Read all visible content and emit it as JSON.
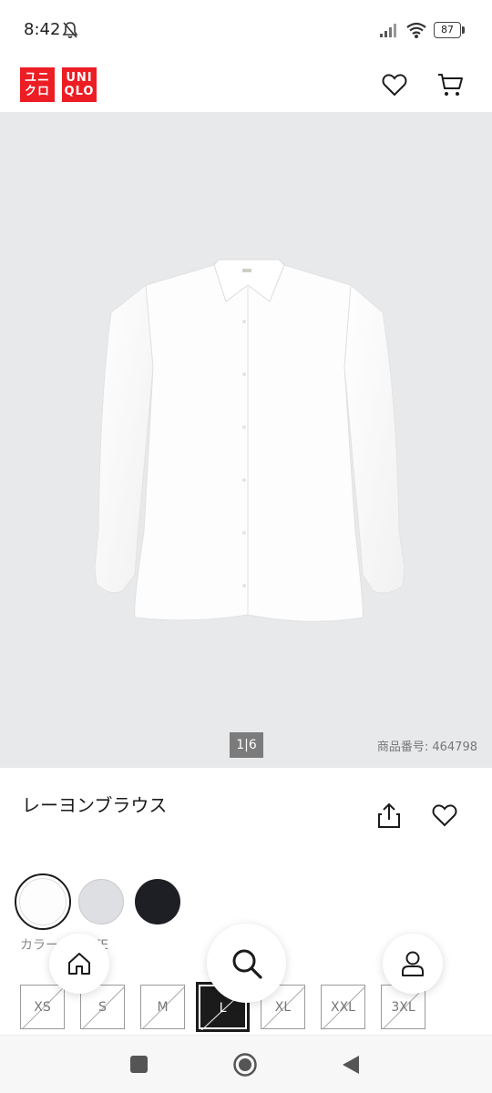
{
  "status_bar": {
    "time": "8:42",
    "battery": "87",
    "icons": [
      "bell-off-icon",
      "signal-icon",
      "wifi-icon",
      "battery-icon"
    ]
  },
  "header": {
    "logo": {
      "katakana_lines": [
        "ユニ",
        "クロ"
      ],
      "latin_lines": [
        "UNI",
        "QLO"
      ],
      "color": "#ed1d24"
    },
    "icons": [
      "heart-icon",
      "cart-icon"
    ]
  },
  "gallery": {
    "counter": "1|6",
    "product_number": "商品番号: 464798",
    "background": "#e8e9eb"
  },
  "product": {
    "title": "レーヨンブラウス",
    "icons": [
      "share-icon",
      "heart-icon"
    ]
  },
  "colors": {
    "swatches": [
      {
        "name": "WHITE",
        "hex": "#fdfdfd",
        "selected": true
      },
      {
        "name": "",
        "hex": "#dedfe3",
        "selected": false
      },
      {
        "name": "",
        "hex": "#1e1f24",
        "selected": false
      }
    ],
    "label_prefix": "カラー",
    "label_value": "WHITE"
  },
  "sizes": [
    {
      "label": "XS",
      "available": false,
      "selected": false
    },
    {
      "label": "S",
      "available": false,
      "selected": false
    },
    {
      "label": "M",
      "available": false,
      "selected": false
    },
    {
      "label": "L",
      "available": false,
      "selected": true
    },
    {
      "label": "XL",
      "available": false,
      "selected": false
    },
    {
      "label": "XXL",
      "available": false,
      "selected": false
    },
    {
      "label": "3XL",
      "available": false,
      "selected": false
    }
  ],
  "floating_nav": [
    "home-icon",
    "search-icon",
    "account-icon"
  ],
  "system_nav": [
    "recents-icon",
    "home-circle-icon",
    "back-icon"
  ]
}
